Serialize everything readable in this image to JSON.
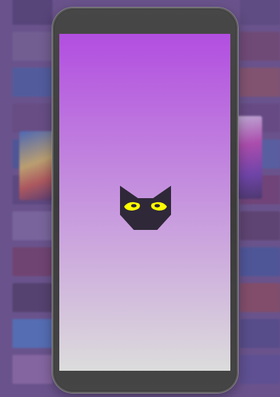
{
  "background": {
    "left_column": [
      {
        "label": "",
        "color": "#3d2f5a"
      },
      {
        "label": "",
        "color": "#6e5e86"
      },
      {
        "label": "",
        "color": "#335a9c"
      },
      {
        "label": "",
        "color": "#5a3e6e"
      },
      {
        "label": "",
        "color": "#2f4f8e"
      },
      {
        "label": "",
        "color": "#4a3566"
      },
      {
        "label": "",
        "color": "#7a6a98"
      },
      {
        "label": "",
        "color": "#6a2f4e"
      },
      {
        "label": "",
        "color": "#3b2a4a"
      },
      {
        "label": "",
        "color": "#3a78c4"
      },
      {
        "label": "",
        "color": "#8e6aa0"
      }
    ],
    "right_column": [
      {
        "label": "",
        "color": "#4a3c6a"
      },
      {
        "label": "",
        "color": "#6a3a56"
      },
      {
        "label": "",
        "color": "#8a4a4a"
      },
      {
        "label": "",
        "color": "#5a3a6e"
      },
      {
        "label": "",
        "color": "#3f5ea0"
      },
      {
        "label": "",
        "color": "#6a2e58"
      },
      {
        "label": "",
        "color": "#4a2f4e"
      },
      {
        "label": "",
        "color": "#2f4f92"
      },
      {
        "label": "",
        "color": "#8a3f3f"
      },
      {
        "label": "",
        "color": "#3d3f78"
      },
      {
        "label": "",
        "color": "#4a4488"
      }
    ]
  },
  "phone": {
    "screen_gradient": [
      "#b24ee0",
      "#dcdcdc"
    ]
  },
  "splash_logo": {
    "icon": "masked-face-logo-icon",
    "body_color": "#2f2838",
    "eye_color": "#ffff00"
  }
}
